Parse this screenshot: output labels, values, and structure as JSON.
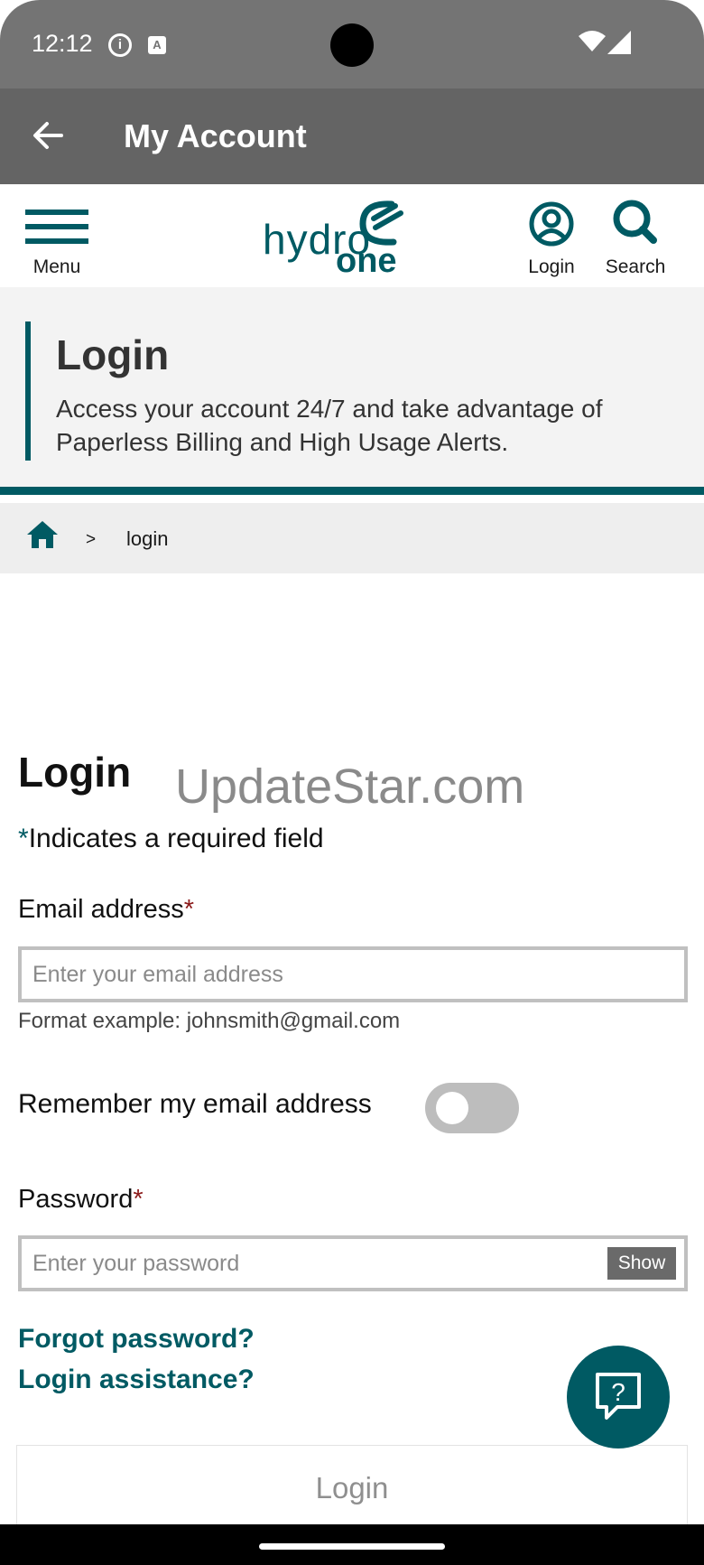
{
  "status_bar": {
    "time": "12:12",
    "info_glyph": "i",
    "a_glyph": "A"
  },
  "app_bar": {
    "title": "My Account",
    "icon": "back-arrow-icon"
  },
  "header": {
    "menu_label": "Menu",
    "logo_hydro": "hydro",
    "logo_one": "one",
    "login_label": "Login",
    "search_label": "Search"
  },
  "hero": {
    "title": "Login",
    "text": "Access your account 24/7 and take advantage of Paperless Billing and High Usage Alerts."
  },
  "breadcrumb": {
    "separator": ">",
    "current": "login",
    "icon": "home-icon"
  },
  "form": {
    "title": "Login",
    "watermark": "UpdateStar.com",
    "required_marker": "*",
    "required_note": "Indicates a required field",
    "email_label": "Email address",
    "email_placeholder": "Enter your email address",
    "email_value": "",
    "email_helper": "Format example: johnsmith@gmail.com",
    "remember_label": "Remember my email address",
    "remember_on": false,
    "password_label": "Password",
    "password_placeholder": "Enter your password",
    "password_value": "",
    "show_label": "Show",
    "forgot_link": "Forgot password?",
    "assist_link": "Login assistance?",
    "submit_label": "Login"
  },
  "chat": {
    "icon": "chat-help-icon",
    "glyph": "?"
  },
  "colors": {
    "brand": "#005a63",
    "required": "#8b1a1a",
    "app_bar": "#646464"
  }
}
